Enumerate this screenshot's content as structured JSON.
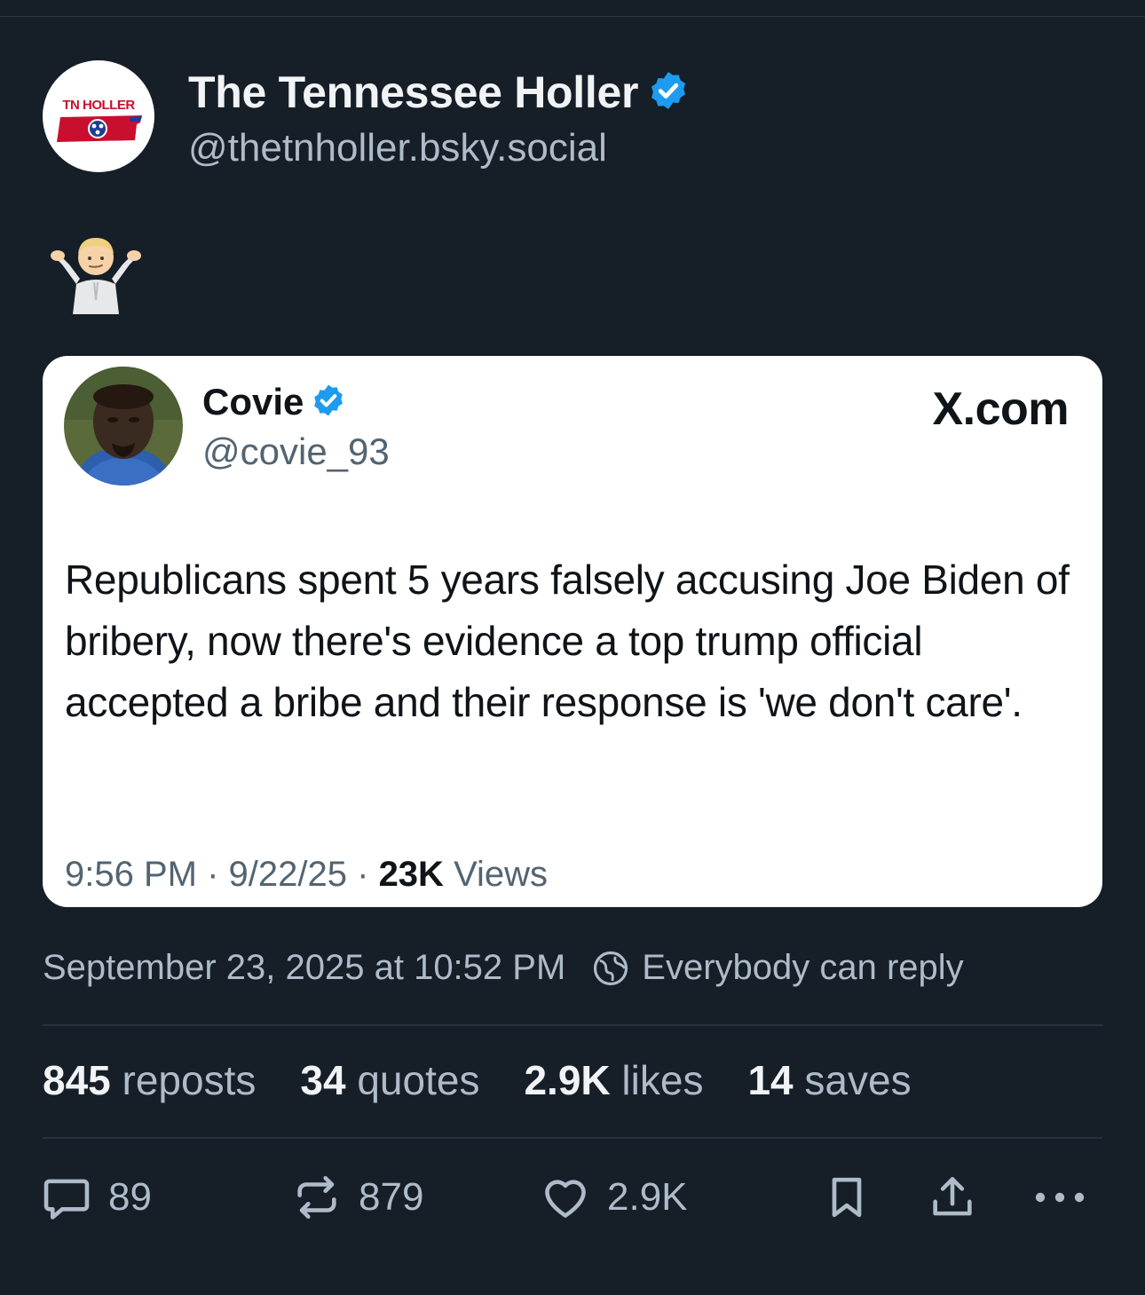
{
  "author": {
    "display_name": "The Tennessee Holler",
    "handle": "@thetnholler.bsky.social",
    "avatar_logo_text": "TN HOLLER",
    "verified_icon": "verified-check-icon"
  },
  "post": {
    "text_emoji": "🤷🏼‍♂️",
    "timestamp": "September 23, 2025 at 10:52 PM",
    "reply_setting": "Everybody can reply"
  },
  "embed": {
    "name": "Covie",
    "handle": "@covie_93",
    "source": "X.com",
    "body": "Republicans spent 5 years falsely accusing Joe Biden of bribery, now there's evidence a top trump official accepted a bribe and their response is 'we don't care'.",
    "time": "9:56 PM",
    "date": "9/22/25",
    "views_count": "23K",
    "views_label": "Views"
  },
  "stats": [
    {
      "num": "845",
      "label": "reposts"
    },
    {
      "num": "34",
      "label": "quotes"
    },
    {
      "num": "2.9K",
      "label": "likes"
    },
    {
      "num": "14",
      "label": "saves"
    }
  ],
  "actions": {
    "reply_count": "89",
    "repost_count": "879",
    "like_count": "2.9K"
  },
  "colors": {
    "background": "#161e27",
    "accent": "#1d9bf0",
    "muted_text": "#aebbc9"
  }
}
